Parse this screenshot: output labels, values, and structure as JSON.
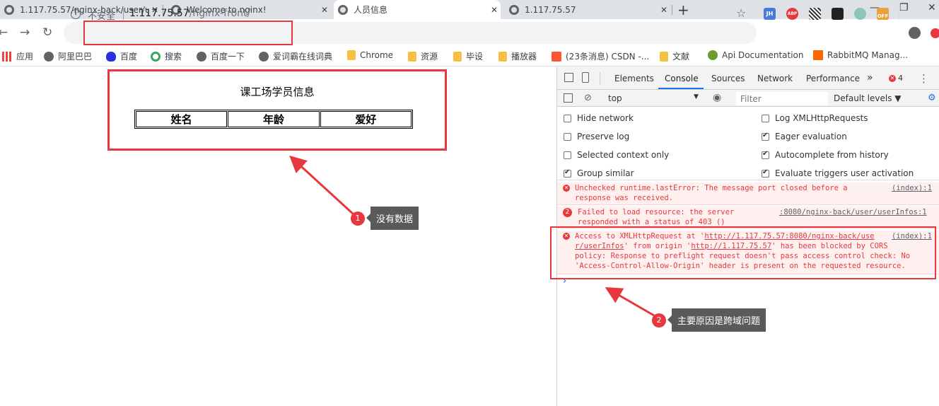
{
  "tabs": [
    {
      "title": "1.117.75.57/nginx-back/user/u",
      "close": "✕"
    },
    {
      "title": "Welcome to nginx!",
      "close": "✕"
    },
    {
      "title": "人员信息",
      "close": "✕"
    },
    {
      "title": "1.117.75.57",
      "close": "✕"
    }
  ],
  "new_tab_icon": "+",
  "window_controls": {
    "minimize": "—",
    "restore": "❐",
    "close": "✕"
  },
  "toolbar": {
    "back_icon": "←",
    "forward_icon": "→",
    "reload_icon": "↻",
    "info_icon": "i",
    "insecure_label": "不安全",
    "url_host": "1.117.75.57",
    "url_path": "/nginx-front/",
    "star_icon": "☆",
    "extensions": [
      "JH",
      "ABP",
      "",
      "",
      "",
      "OFF"
    ],
    "profile_icon": "profile",
    "menu_icon": "⋮"
  },
  "bookmarks": [
    {
      "label": "应用",
      "icon": "apps"
    },
    {
      "label": "阿里巴巴",
      "icon": "globe"
    },
    {
      "label": "百度",
      "icon": "baidu"
    },
    {
      "label": "搜索",
      "icon": "search"
    },
    {
      "label": "百度一下",
      "icon": "globe"
    },
    {
      "label": "爱词霸在线词典",
      "icon": "globe"
    },
    {
      "label": "Chrome",
      "icon": "folder"
    },
    {
      "label": "资源",
      "icon": "folder"
    },
    {
      "label": "毕设",
      "icon": "folder"
    },
    {
      "label": "播放器",
      "icon": "folder"
    },
    {
      "label": "(23条消息) CSDN -...",
      "icon": "csdn"
    },
    {
      "label": "文献",
      "icon": "folder"
    },
    {
      "label": "Api Documentation",
      "icon": "api"
    },
    {
      "label": "RabbitMQ Manag...",
      "icon": "rabbitmq"
    }
  ],
  "page": {
    "title": "课工场学员信息",
    "table_headers": [
      "姓名",
      "年龄",
      "爱好"
    ]
  },
  "annotations": [
    {
      "number": "1",
      "label": "没有数据"
    },
    {
      "number": "2",
      "label": "主要原因是跨域问题"
    }
  ],
  "devtools": {
    "tabs": [
      "Elements",
      "Console",
      "Sources",
      "Network",
      "Performance",
      "»"
    ],
    "active_tab": "Console",
    "error_count": "4",
    "context": "top",
    "filter_placeholder": "Filter",
    "levels": "Default levels ▼",
    "options_left": [
      {
        "label": "Hide network",
        "checked": false
      },
      {
        "label": "Preserve log",
        "checked": false
      },
      {
        "label": "Selected context only",
        "checked": false
      },
      {
        "label": "Group similar",
        "checked": true
      }
    ],
    "options_right": [
      {
        "label": "Log XMLHttpRequests",
        "checked": false
      },
      {
        "label": "Eager evaluation",
        "checked": true
      },
      {
        "label": "Autocomplete from history",
        "checked": true
      },
      {
        "label": "Evaluate triggers user activation",
        "checked": true
      }
    ],
    "messages": [
      {
        "icon": "✕",
        "text": "Unchecked runtime.lastError: The message port closed before a\nresponse was received.",
        "source": "(index):1"
      },
      {
        "icon": "2",
        "text": "Failed to load resource: the server\nresponded with a status of 403 ()",
        "source": ":8080/nginx-back/user/userInfos:1"
      },
      {
        "icon": "✕",
        "source": "(index):1",
        "p1": "Access to XMLHttpRequest at '",
        "link1": "http://1.117.75.57:8080/nginx-back/use",
        "p2": "r/userInfos",
        "p3": "' from origin '",
        "link2": "http://1.117.75.57",
        "p4": "' has been blocked by CORS",
        "line3": "policy: Response to preflight request doesn't pass access control check: No",
        "line4": "'Access-Control-Allow-Origin' header is present on the requested resource."
      }
    ],
    "prompt": "›"
  },
  "colors": {
    "accent": "#e8383d",
    "link": "#1a73e8"
  }
}
